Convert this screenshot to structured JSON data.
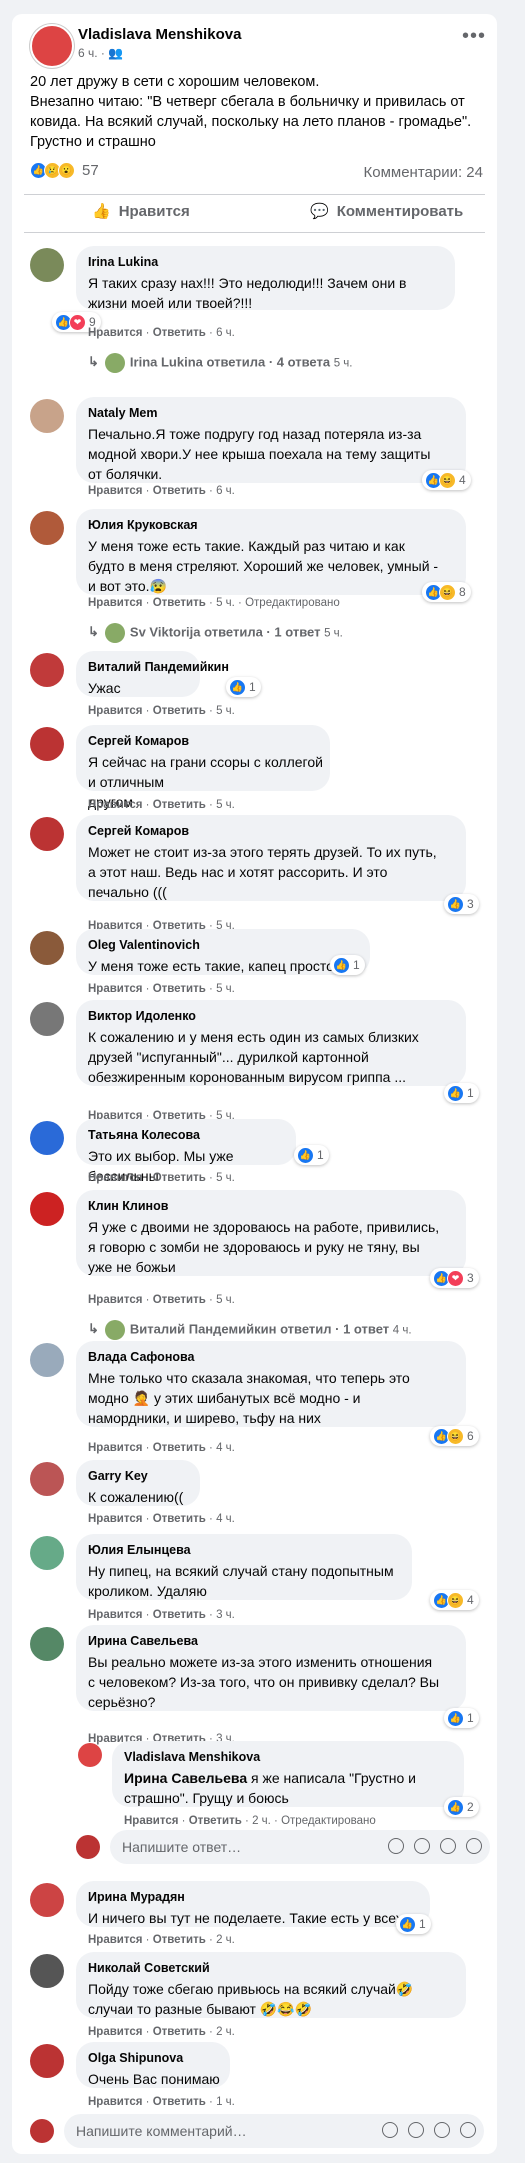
{
  "post": {
    "author": "Vladislava Menshikova",
    "time": "6 ч.",
    "audience_icon": "friends-icon",
    "more_icon": "more-dots-icon",
    "text_lines": [
      "20 лет дружу в сети с хорошим человеком.",
      "Внезапно читаю: \"В четверг сбегала в больничку и привилась от",
      "ковида. На всякий случай, поскольку на лето планов - громадье\".",
      "Грустно и страшно"
    ],
    "reactions_count": "57",
    "comments_count": "Комментарии: 24",
    "like_label": "Нравится",
    "comment_label": "Комментировать"
  },
  "labels": {
    "like": "Нравится",
    "reply": "Ответить",
    "edited": "Отредактировано",
    "reply_placeholder": "Напишите ответ…",
    "comment_placeholder": "Напишите комментарий…"
  },
  "colors": {
    "accent": "#1877f2",
    "bubble": "#f0f2f5",
    "meta": "#65676b",
    "text": "#050505"
  },
  "comments": [
    {
      "name": "Irina Lukina",
      "lines": [
        "Я таких сразу нах!!! Это недолюди!!! Зачем они в",
        "жизни моей или твоей?!!!"
      ],
      "time": "6 ч.",
      "reactions": "9",
      "replies_summary": {
        "name": "Irina Lukina",
        "text": "ответила · 4 ответа",
        "time": "5 ч."
      }
    },
    {
      "name": "Nataly Mem",
      "lines": [
        "Печально.Я тоже подругу год назад потеряла из-за",
        "модной хвори.У нее крыша поехала на тему защиты",
        "от болячки."
      ],
      "time": "6 ч.",
      "reactions": "4"
    },
    {
      "name": "Юлия Круковская",
      "lines": [
        "У меня тоже есть такие. Каждый раз читаю и как",
        "будто в меня стреляют. Хороший же человек, умный -",
        "и вот это.😰"
      ],
      "time": "5 ч.",
      "edited": true,
      "reactions": "8",
      "replies_summary": {
        "name": "Sv Viktorija",
        "text": "ответила · 1 ответ",
        "time": "5 ч."
      }
    },
    {
      "name": "Виталий Пандемийкин",
      "lines": [
        "Ужас"
      ],
      "time": "5 ч.",
      "reactions": "1"
    },
    {
      "name": "Сергей Комаров",
      "lines": [
        "Я сейчас на грани ссоры с коллегой и отличным",
        "другом"
      ],
      "time": "5 ч."
    },
    {
      "name": "Сергей Комаров",
      "lines": [
        "Может не стоит из-за этого терять друзей. То их путь,",
        "а этот наш. Ведь нас и хотят рассорить. И это",
        "печально ((("
      ],
      "time": "5 ч.",
      "reactions": "3"
    },
    {
      "name": "Oleg Valentinovich",
      "lines": [
        "У меня тоже есть такие, капец просто..."
      ],
      "time": "5 ч.",
      "reactions": "1"
    },
    {
      "name": "Виктор Идоленко",
      "lines": [
        "К сожалению и у меня есть один из самых близких",
        "друзей \"испуганный\"... дурилкой картонной",
        "обезжиренным коронованным вирусом гриппа ..."
      ],
      "time": "5 ч.",
      "reactions": "1"
    },
    {
      "name": "Татьяна Колесова",
      "lines": [
        "Это их выбор. Мы уже бессильны"
      ],
      "time": "5 ч.",
      "reactions": "1"
    },
    {
      "name": "Клин Клинов",
      "lines": [
        "Я уже с двоими не здороваюсь на работе, привились,",
        "я говорю с зомби не здороваюсь и руку не тяну, вы",
        "уже не божьи"
      ],
      "time": "5 ч.",
      "reactions": "3",
      "replies_summary": {
        "name": "Виталий Пандемийкин",
        "text": "ответил · 1 ответ",
        "time": "4 ч."
      }
    },
    {
      "name": "Влада Сафонова",
      "lines": [
        "Мне только что сказала знакомая, что теперь это",
        "модно 🤦 у этих шибанутых всё модно - и",
        "намордники, и ширево, тьфу на них"
      ],
      "time": "4 ч.",
      "reactions": "6"
    },
    {
      "name": "Garry Key",
      "lines": [
        "К сожалению(("
      ],
      "time": "4 ч."
    },
    {
      "name": "Юлия Елынцева",
      "lines": [
        "Ну пипец, на всякий случай стану подопытным",
        "кроликом. Удаляю"
      ],
      "time": "3 ч.",
      "reactions": "4"
    },
    {
      "name": "Ирина Савельева",
      "lines": [
        "Вы реально можете из-за этого изменить отношения",
        "с человеком? Из-за того, что он прививку сделал? Вы",
        "серьёзно?"
      ],
      "time": "3 ч.",
      "reactions": "1"
    },
    {
      "name": "Vladislava Menshikova",
      "mention": "Ирина Савельева",
      "lines": [
        " я же написала \"Грустно и",
        "страшно\". Грущу и боюсь"
      ],
      "time": "2 ч.",
      "edited": true,
      "reactions": "2"
    },
    {
      "name": "Ирина Мурадян",
      "lines": [
        "И ничего вы тут не поделаете. Такие есть у всех."
      ],
      "time": "2 ч.",
      "reactions": "1"
    },
    {
      "name": "Николай Советский",
      "lines": [
        "Пойду тоже сбегаю привьюсь на всякий случай🤣",
        "случаи то разные бывают 🤣😂🤣"
      ],
      "time": "2 ч."
    },
    {
      "name": "Olga Shipunova",
      "lines": [
        "Очень Вас понимаю"
      ],
      "time": "1 ч."
    }
  ]
}
